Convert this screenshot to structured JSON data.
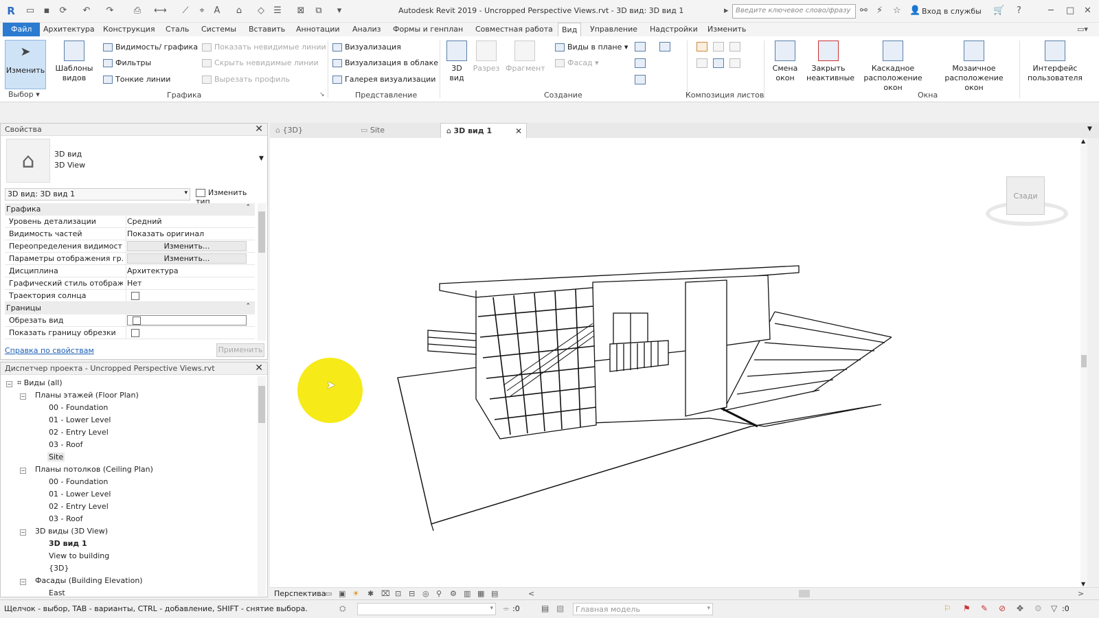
{
  "window": {
    "title": "Autodesk Revit 2019 - Uncropped Perspective Views.rvt - 3D вид: 3D вид 1",
    "search_placeholder": "Введите ключевое слово/фразу",
    "signin": "Вход в службы"
  },
  "menu": {
    "tabs": [
      "Файл",
      "Архитектура",
      "Конструкция",
      "Сталь",
      "Системы",
      "Вставить",
      "Аннотации",
      "Анализ",
      "Формы и генплан",
      "Совместная работа",
      "Вид",
      "Управление",
      "Надстройки",
      "Изменить"
    ],
    "active_tab": "Вид"
  },
  "ribbon": {
    "modify": "Изменить",
    "select": "Выбор",
    "templates": [
      "Шаблоны",
      "видов"
    ],
    "vg": "Видимость/ графика",
    "filters": "Фильтры",
    "thin_lines": "Тонкие линии",
    "show_hidden": "Показать невидимые линии",
    "hide_hidden": "Скрыть невидимые линии",
    "cut_profile": "Вырезать профиль",
    "graphics_label": "Графика",
    "render": "Визуализация",
    "render_cloud": "Визуализация  в облаке",
    "render_gallery": "Галерея  визуализации",
    "presentation_label": "Представление",
    "view3d": [
      "3D",
      "вид"
    ],
    "section": "Разрез",
    "callout": "Фрагмент",
    "plan_views": "Виды в плане",
    "elevation": "Фасад",
    "create_label": "Создание",
    "sheet_comp_label": "Композиция листов",
    "switch_windows": [
      "Смена",
      "окон"
    ],
    "close_inactive": [
      "Закрыть",
      "неактивные"
    ],
    "cascade": [
      "Каскадное",
      "расположение окон"
    ],
    "tile": [
      "Мозаичное",
      "расположение окон"
    ],
    "ui": [
      "Интерфейс",
      "пользователя"
    ],
    "windows_label": "Окна"
  },
  "properties": {
    "header": "Свойства",
    "type_line1": "3D вид",
    "type_line2": "3D View",
    "selector": "3D вид: 3D вид 1",
    "edit_type": "Изменить тип",
    "section_graphics": "Графика",
    "rows": [
      {
        "k": "Уровень детализации",
        "v": "Средний"
      },
      {
        "k": "Видимость частей",
        "v": "Показать оригинал"
      },
      {
        "k": "Переопределения видимост...",
        "v": "Изменить..."
      },
      {
        "k": "Параметры отображения гр...",
        "v": "Изменить..."
      },
      {
        "k": "Дисциплина",
        "v": "Архитектура"
      },
      {
        "k": "Графический стиль отображ...",
        "v": "Нет"
      },
      {
        "k": "Траектория солнца",
        "v": ""
      }
    ],
    "section_extents": "Границы",
    "rows2": [
      {
        "k": "Обрезать вид",
        "v": ""
      },
      {
        "k": "Показать границу обрезки",
        "v": ""
      }
    ],
    "help_link": "Справка по свойствам",
    "apply": "Применить"
  },
  "browser": {
    "header": "Диспетчер проекта - Uncropped Perspective Views.rvt",
    "root": "Виды (all)",
    "floor_plans": "Планы этажей (Floor Plan)",
    "floor_items": [
      "00 - Foundation",
      "01 - Lower Level",
      "02 - Entry Level",
      "03 - Roof",
      "Site"
    ],
    "ceiling_plans": "Планы потолков (Ceiling Plan)",
    "ceiling_items": [
      "00 - Foundation",
      "01 - Lower Level",
      "02 - Entry Level",
      "03 - Roof"
    ],
    "views3d": "3D виды (3D View)",
    "views3d_items": [
      "3D вид 1",
      "View to building",
      "{3D}"
    ],
    "elevations": "Фасады (Building Elevation)",
    "elev_items": [
      "East"
    ]
  },
  "view_tabs": [
    "{3D}",
    "Site",
    "3D вид 1"
  ],
  "viewcube_face": "Сзади",
  "view_control": "Перспектива",
  "status": {
    "hint": "Щелчок - выбор, TAB - варианты, CTRL - добавление, SHIFT - снятие выбора.",
    "count1": ":0",
    "model": "Главная модель",
    "count2": ":0"
  }
}
